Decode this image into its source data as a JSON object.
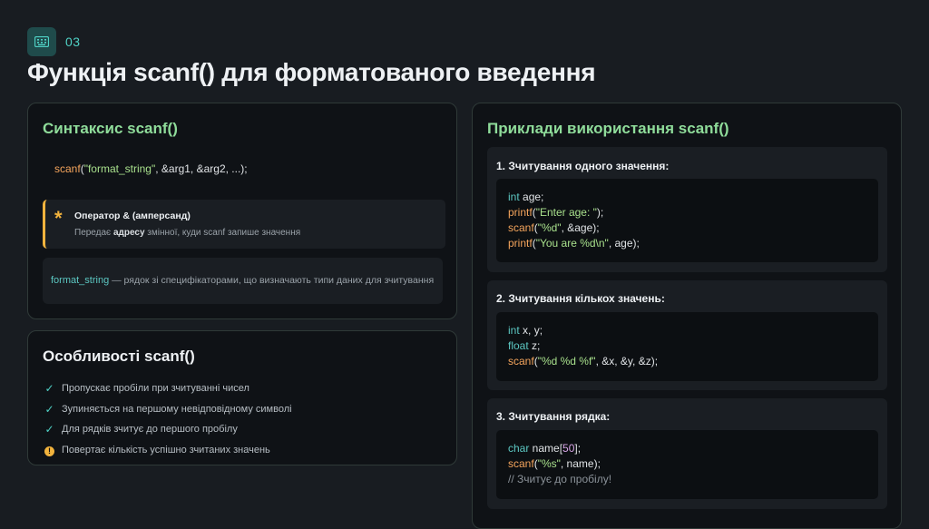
{
  "slide": {
    "number": "03",
    "icon": "keyboard-icon",
    "title": "Функція scanf() для форматованого введення"
  },
  "syntax": {
    "title": "Синтаксис scanf()",
    "code": {
      "fn": "scanf",
      "open": "(",
      "str": "\"format_string\"",
      "rest": ", &arg1, &arg2, ...);"
    },
    "operator": {
      "icon": "asterisk-icon",
      "title": "Оператор & (амперсанд)",
      "desc_before": "Передає ",
      "desc_bold": "адресу",
      "desc_after": " змінної, куди scanf запише значення"
    },
    "format": {
      "term": "format_string",
      "desc": " — рядок зі специфікаторами, що визначають типи даних для зчитування"
    }
  },
  "features": {
    "title": "Особливості scanf()",
    "items": [
      {
        "icon": "check-icon",
        "text": "Пропускає пробіли при зчитуванні чисел"
      },
      {
        "icon": "check-icon",
        "text": "Зупиняється на першому невідповідному символі"
      },
      {
        "icon": "check-icon",
        "text": "Для рядків зчитує до першого пробілу"
      },
      {
        "icon": "warning-icon",
        "text": "Повертає кількість успішно зчитаних значень"
      }
    ]
  },
  "examples": {
    "title": "Приклади використання scanf()",
    "ex1": {
      "heading": "1. Зчитування одного значення:",
      "l1": {
        "kw": "int",
        "rest": " age;"
      },
      "l2": {
        "fn": "printf",
        "open": "(",
        "str": "\"Enter age: \"",
        "rest": ");"
      },
      "l3": {
        "fn": "scanf",
        "open": "(",
        "str": "\"%d\"",
        "rest": ", &age);"
      },
      "l4": {
        "fn": "printf",
        "open": "(",
        "str": "\"You are %d\\n\"",
        "rest": ", age);"
      }
    },
    "ex2": {
      "heading": "2. Зчитування кількох значень:",
      "l1": {
        "kw": "int",
        "rest": " x, y;"
      },
      "l2": {
        "kw": "float",
        "rest": " z;"
      },
      "l3": {
        "fn": "scanf",
        "open": "(",
        "str": "\"%d %d %f\"",
        "rest": ", &x, &y, &z);"
      }
    },
    "ex3": {
      "heading": "3. Зчитування рядка:",
      "l1": {
        "kw": "char",
        "a": " name[",
        "num": "50",
        "b": "];"
      },
      "l2": {
        "fn": "scanf",
        "open": "(",
        "str": "\"%s\"",
        "rest": ", name);"
      },
      "l3": {
        "cm": "// Зчитує до пробілу!"
      }
    }
  },
  "colors": {
    "accent_teal": "#4fd1c5",
    "heading_green": "#8fdc9a",
    "orange": "#f4a45c",
    "amber": "#f2b33d"
  }
}
